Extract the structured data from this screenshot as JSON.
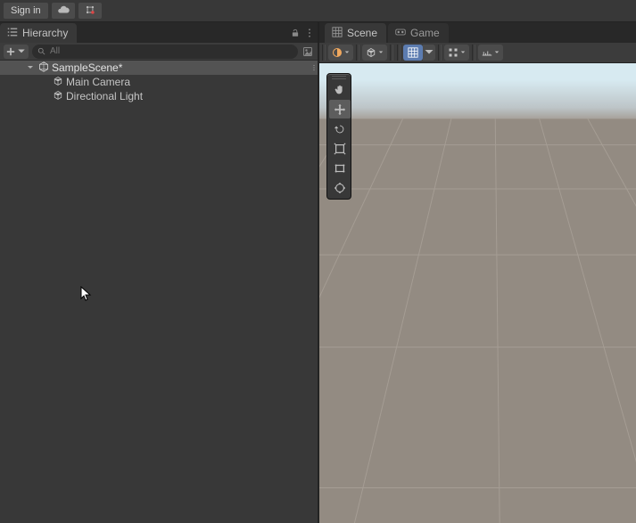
{
  "topbar": {
    "signin_label": "Sign in"
  },
  "hierarchy": {
    "tab_label": "Hierarchy",
    "search_placeholder": "All",
    "scene_name": "SampleScene*",
    "children": [
      {
        "name": "Main Camera"
      },
      {
        "name": "Directional Light"
      }
    ]
  },
  "sceneview": {
    "tabs": [
      {
        "label": "Scene"
      },
      {
        "label": "Game"
      }
    ]
  },
  "icons": {
    "cloud": "cloud",
    "service": "service",
    "list": "list",
    "lock": "lock",
    "dots": "dots",
    "plus": "plus",
    "caret": "caret",
    "search": "search",
    "save": "save",
    "foldout": "foldout",
    "unity": "unity",
    "cube": "cube",
    "grid": "grid",
    "gizmo_shading": "shading",
    "gizmo_2d": "2d",
    "snapping": "snapping",
    "increment": "increment",
    "scene_icon": "scene",
    "vr": "vr",
    "hand": "hand",
    "move": "move",
    "rotate": "rotate",
    "scale": "scale",
    "rect": "rect",
    "transform": "transform"
  },
  "colors": {
    "accent": "#5c7cb0",
    "bg": "#383838",
    "row_sel": "#535353",
    "ground": "#938b82"
  }
}
